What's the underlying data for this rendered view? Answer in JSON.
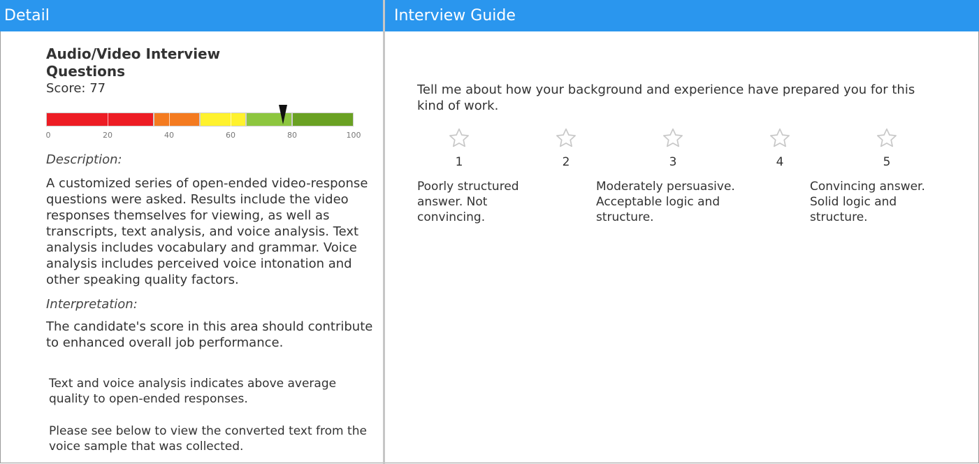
{
  "header": {
    "left_title": "Detail",
    "right_title": "Interview Guide"
  },
  "detail": {
    "title_line1": "Audio/Video Interview",
    "title_line2": "Questions",
    "score_text": "Score: 77",
    "gauge": {
      "score": 77,
      "tick_labels": [
        "0",
        "20",
        "40",
        "60",
        "80",
        "100"
      ],
      "bands": [
        {
          "from": 0,
          "to": 35,
          "color": "#ed1c24"
        },
        {
          "from": 35,
          "to": 50,
          "color": "#f47b20"
        },
        {
          "from": 50,
          "to": 65,
          "color": "#fff22e"
        },
        {
          "from": 65,
          "to": 80,
          "color": "#8dc63f"
        },
        {
          "from": 80,
          "to": 100,
          "color": "#6aa123"
        }
      ]
    },
    "description_label": "Description:",
    "description_text": "A customized series of open-ended video-response questions were asked. Results include the video responses themselves for viewing, as well as  transcripts, text analysis, and voice analysis. Text analysis includes vocabulary and grammar. Voice analysis includes perceived voice intonation and other speaking quality factors.",
    "interpretation_label": "Interpretation:",
    "interpretation_text": "The candidate's score in this area should contribute to enhanced overall job performance.",
    "note1": "Text and voice analysis indicates above average quality  to open-ended responses.",
    "note2": "Please see below to view the converted text from the voice sample that was collected."
  },
  "guide": {
    "question": "Tell me about how your background and experience have prepared you for this kind of work.",
    "ratings": [
      "1",
      "2",
      "3",
      "4",
      "5"
    ],
    "descriptions": [
      "Poorly structured answer. Not convincing.",
      "Moderately persuasive. Acceptable logic and structure.",
      "Convincing answer. Solid logic and structure."
    ],
    "star_icon": "star-outline-icon",
    "star_color": "#c8c8c8"
  }
}
